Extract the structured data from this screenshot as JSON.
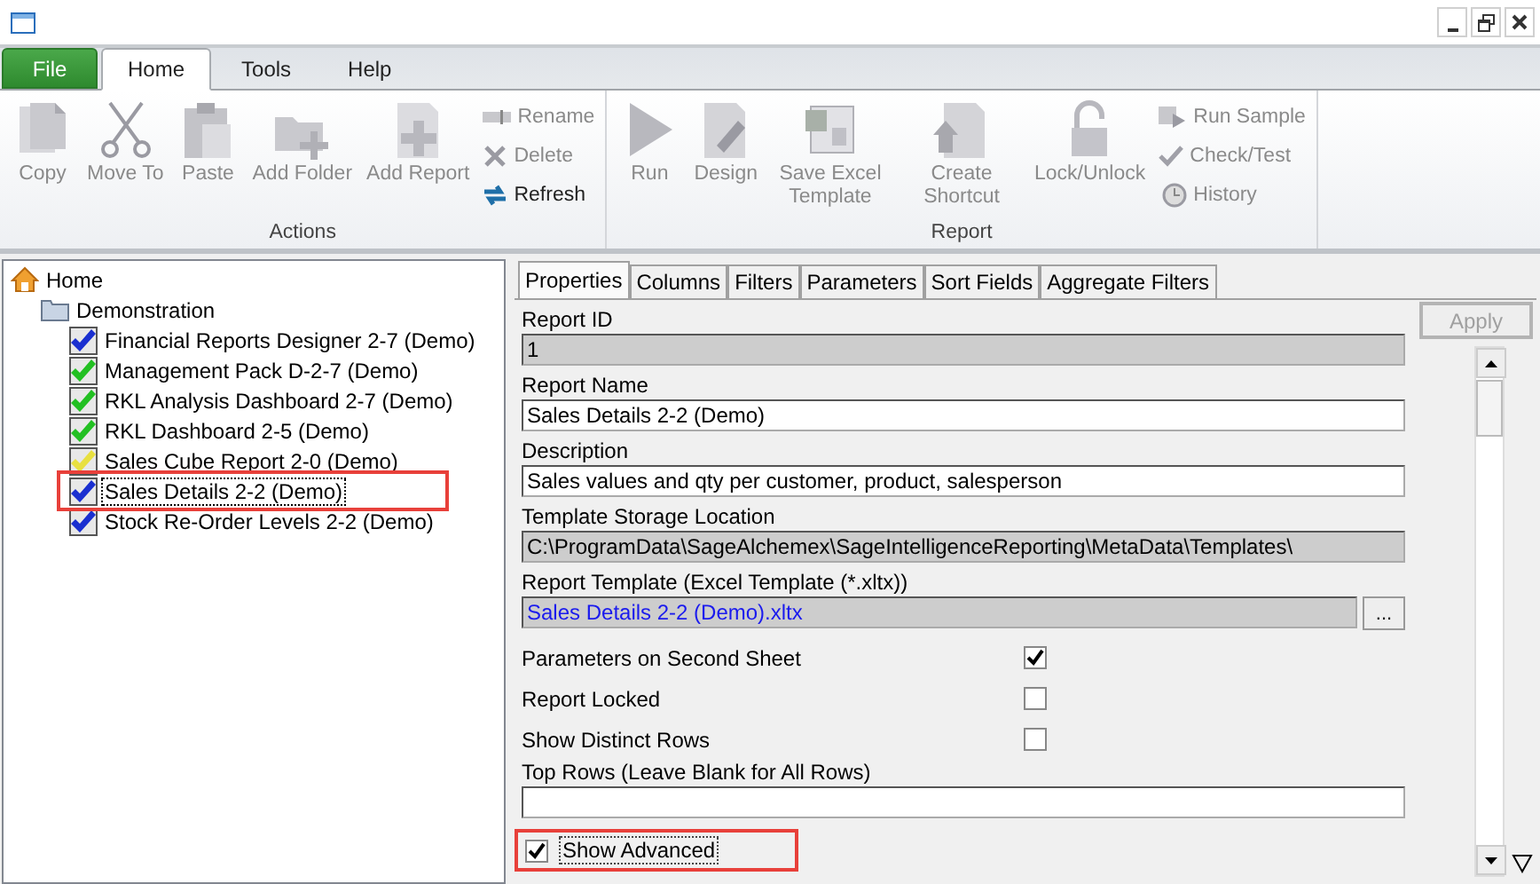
{
  "ribbon": {
    "tabs": [
      {
        "label": "File",
        "kind": "file",
        "selected": false
      },
      {
        "label": "Home",
        "kind": "tab",
        "selected": true
      },
      {
        "label": "Tools",
        "kind": "tab",
        "selected": false
      },
      {
        "label": "Help",
        "kind": "tab",
        "selected": false
      }
    ],
    "groups": [
      {
        "label": "Actions",
        "buttons": [
          {
            "label": "Copy",
            "kind": "large",
            "disabled": true
          },
          {
            "label": "Move To",
            "kind": "large",
            "disabled": true
          },
          {
            "label": "Paste",
            "kind": "large",
            "disabled": true
          },
          {
            "label": "Add Folder",
            "kind": "large",
            "disabled": true
          },
          {
            "label": "Add Report",
            "kind": "large",
            "disabled": true
          },
          {
            "label": "Rename",
            "kind": "small",
            "disabled": true
          },
          {
            "label": "Delete",
            "kind": "small",
            "disabled": true
          },
          {
            "label": "Refresh",
            "kind": "small",
            "disabled": false
          }
        ]
      },
      {
        "label": "Report",
        "buttons": [
          {
            "label": "Run",
            "kind": "large",
            "disabled": true
          },
          {
            "label": "Design",
            "kind": "large",
            "disabled": true
          },
          {
            "label": "Save Excel Template",
            "kind": "large",
            "disabled": true
          },
          {
            "label": "Create Shortcut",
            "kind": "large",
            "disabled": true
          },
          {
            "label": "Lock/Unlock",
            "kind": "large",
            "disabled": true
          },
          {
            "label": "Run Sample",
            "kind": "small",
            "disabled": true
          },
          {
            "label": "Check/Test",
            "kind": "small",
            "disabled": true
          },
          {
            "label": "History",
            "kind": "small",
            "disabled": true
          }
        ]
      }
    ]
  },
  "tree": {
    "label": "Home",
    "children": [
      {
        "label": "Demonstration",
        "children": [
          {
            "label": "Financial Reports Designer 2-7 (Demo)",
            "color": "#1a2fd0",
            "selected": false,
            "highlighted": false
          },
          {
            "label": "Management Pack D-2-7 (Demo)",
            "color": "#22c022",
            "selected": false,
            "highlighted": false
          },
          {
            "label": "RKL Analysis Dashboard 2-7 (Demo)",
            "color": "#22c022",
            "selected": false,
            "highlighted": false
          },
          {
            "label": "RKL Dashboard 2-5 (Demo)",
            "color": "#22c022",
            "selected": false,
            "highlighted": false
          },
          {
            "label": "Sales Cube Report 2-0 (Demo)",
            "color": "#e8e040",
            "selected": false,
            "highlighted": false
          },
          {
            "label": "Sales Details 2-2 (Demo)",
            "color": "#1a2fd0",
            "selected": true,
            "highlighted": true
          },
          {
            "label": "Stock Re-Order Levels 2-2 (Demo)",
            "color": "#1a2fd0",
            "selected": false,
            "highlighted": false
          }
        ]
      }
    ]
  },
  "properties": {
    "tabs": [
      {
        "label": "Properties",
        "selected": true
      },
      {
        "label": "Columns",
        "selected": false
      },
      {
        "label": "Filters",
        "selected": false
      },
      {
        "label": "Parameters",
        "selected": false
      },
      {
        "label": "Sort Fields",
        "selected": false
      },
      {
        "label": "Aggregate Filters",
        "selected": false
      }
    ],
    "apply_button": {
      "label": "Apply",
      "disabled": true
    },
    "fields": [
      {
        "kind": "text",
        "label": "Report ID",
        "value": "1",
        "readonly": true
      },
      {
        "kind": "text",
        "label": "Report Name",
        "value": "Sales Details 2-2 (Demo)",
        "readonly": false
      },
      {
        "kind": "text",
        "label": "Description",
        "value": "Sales values and qty per customer, product, salesperson",
        "readonly": false
      },
      {
        "kind": "text",
        "label": "Template Storage Location",
        "value": "C:\\ProgramData\\SageAlchemex\\SageIntelligenceReporting\\MetaData\\Templates\\",
        "readonly": true
      },
      {
        "kind": "file",
        "label": "Report Template (Excel Template (*.xltx))",
        "value": "Sales Details 2-2 (Demo).xltx",
        "readonly": true,
        "browse": "..."
      },
      {
        "kind": "check",
        "label": "Parameters on Second Sheet",
        "checked": true
      },
      {
        "kind": "check",
        "label": "Report Locked",
        "checked": false
      },
      {
        "kind": "check",
        "label": "Show Distinct Rows",
        "checked": false
      },
      {
        "kind": "text",
        "label": "Top Rows (Leave Blank for All Rows)",
        "readonly": false
      }
    ],
    "show_advanced": {
      "label": "Show Advanced",
      "checked": true,
      "highlighted": true
    }
  }
}
